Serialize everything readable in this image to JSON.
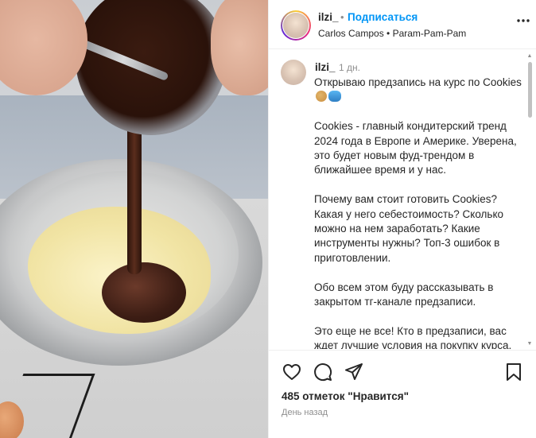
{
  "header": {
    "username": "ilzi_",
    "separator": "•",
    "follow_label": "Подписаться",
    "subtitle": "Carlos Campos • Param-Pam-Pam"
  },
  "caption": {
    "username": "ilzi_",
    "time": "1 дн.",
    "paragraphs": [
      "Открываю предзапись на курс по Cookies",
      "Cookies - главный кондитерский тренд 2024 года в Европе и Америке. Уверена, это будет новым фуд-трендом в ближайшее время и у нас.",
      "Почему вам стоит готовить Cookies? Какая у него себестоимость? Сколько можно на нем заработать? Какие инструменты нужны? Топ-3 ошибок в приготовлении.",
      "Обо всем этом буду рассказывать в закрытом тг-канале предзаписи.",
      "Это еще не все! Кто в предзаписи, вас ждет лучшие условия на покупку курса, бесплатные подарки"
    ]
  },
  "actions": {
    "likes": "485 отметок \"Нравится\"",
    "date": "День назад"
  },
  "icons": {
    "like": "heart-icon",
    "comment": "comment-icon",
    "share": "share-icon",
    "save": "bookmark-icon",
    "more": "more-icon"
  },
  "colors": {
    "accent": "#0095f6",
    "text": "#262626",
    "muted": "#8e8e8e"
  }
}
